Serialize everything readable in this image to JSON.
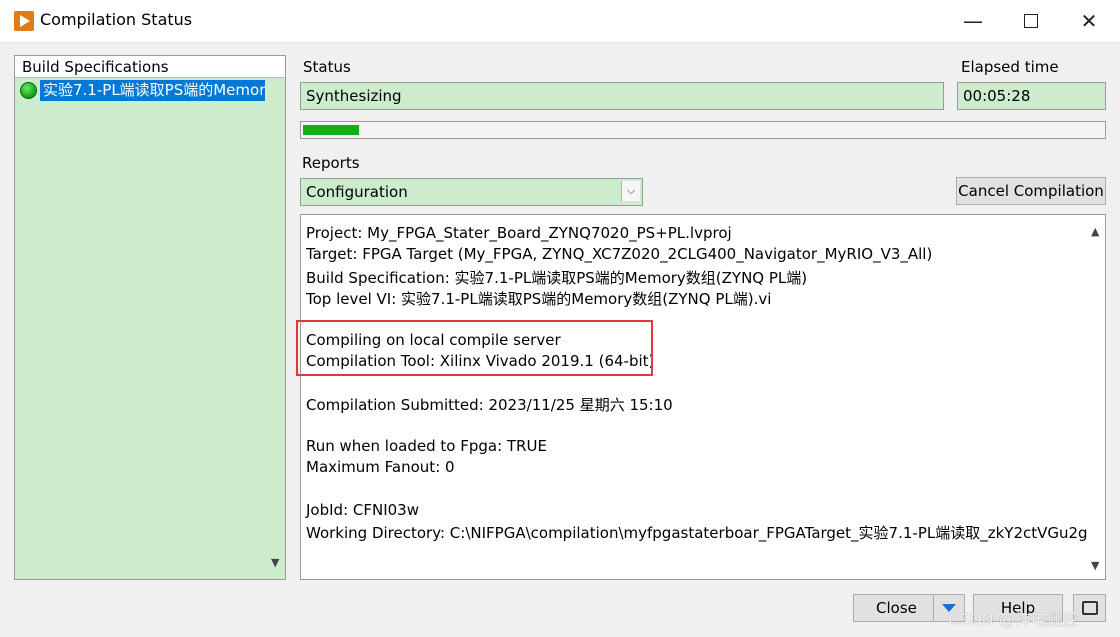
{
  "window": {
    "title": "Compilation Status"
  },
  "build_specs": {
    "header": "Build Specifications",
    "items": [
      {
        "label": "实验7.1-PL端读取PS端的Memor"
      }
    ]
  },
  "status": {
    "label": "Status",
    "value": "Synthesizing"
  },
  "elapsed": {
    "label": "Elapsed time",
    "value": "00:05:28"
  },
  "progress": {
    "fraction": 0.07
  },
  "reports": {
    "label": "Reports",
    "selected": "Configuration"
  },
  "buttons": {
    "cancel": "Cancel Compilation",
    "close": "Close",
    "help": "Help"
  },
  "report_lines": [
    "Project: My_FPGA_Stater_Board_ZYNQ7020_PS+PL.lvproj",
    "Target: FPGA Target (My_FPGA, ZYNQ_XC7Z020_2CLG400_Navigator_MyRIO_V3_All)",
    "Build Specification: 实验7.1-PL端读取PS端的Memory数组(ZYNQ PL端)",
    "Top level VI: 实验7.1-PL端读取PS端的Memory数组(ZYNQ PL端).vi",
    "",
    "Compiling on local compile server",
    "Compilation Tool: Xilinx Vivado 2019.1 (64-bit)",
    "",
    "Compilation Submitted: 2023/11/25 星期六 15:10",
    "",
    "Run when loaded to Fpga: TRUE",
    "Maximum Fanout: 0",
    "",
    "JobId: CFNI03w",
    "Working Directory: C:\\NIFPGA\\compilation\\myfpgastaterboar_FPGATarget_实验7.1-PL端读取_zkY2ctVGu2g"
  ],
  "watermark": "CSDN @神电测控",
  "colors": {
    "field_bg": "#cdebcd",
    "progress": "#0fb00f",
    "selection": "#0078d7",
    "highlight": "#e0383f"
  }
}
